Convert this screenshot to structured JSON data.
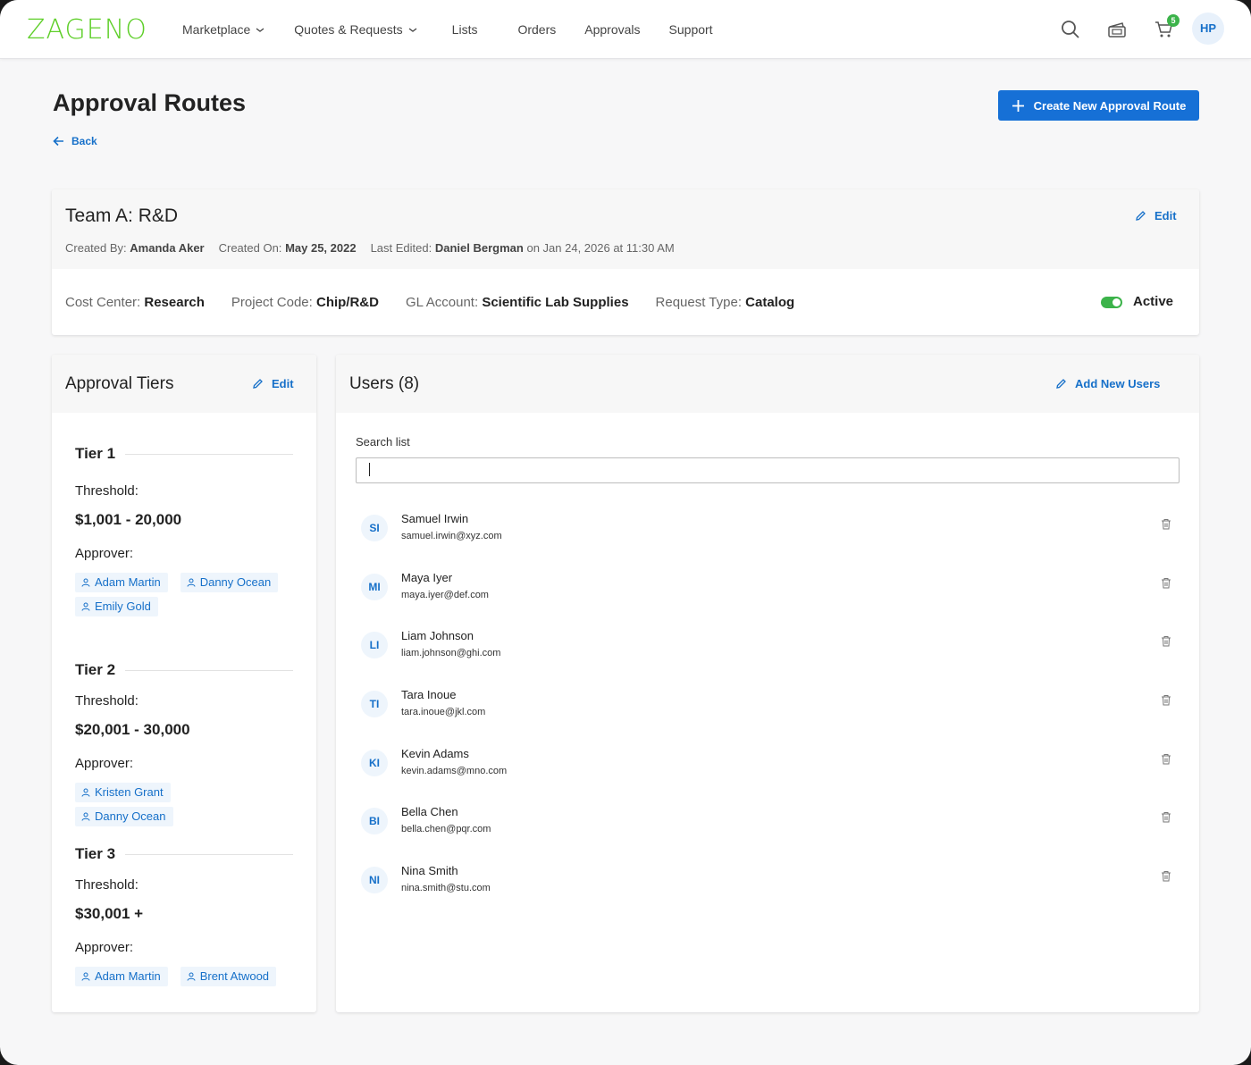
{
  "header": {
    "logo": "ZAGENO",
    "nav": [
      {
        "label": "Marketplace",
        "has_dropdown": true
      },
      {
        "label": "Quotes & Requests",
        "has_dropdown": true
      },
      {
        "label": "Lists",
        "has_dropdown": false
      },
      {
        "label": "Orders",
        "has_dropdown": false
      },
      {
        "label": "Approvals",
        "has_dropdown": false
      },
      {
        "label": "Support",
        "has_dropdown": false
      }
    ],
    "icons": [
      "search-icon",
      "quotes-icon",
      "cart-icon"
    ],
    "cart_count": "5",
    "avatar_initials": "HP"
  },
  "page": {
    "title": "Approval Routes",
    "back_label": "Back",
    "create_button": "Create New Approval Route"
  },
  "route": {
    "name": "Team A: R&D",
    "edit_label": "Edit",
    "created_by_label": "Created By:",
    "created_by": "Amanda Aker",
    "created_on_label": "Created On:",
    "created_on": "May 25, 2022",
    "last_edited_label": "Last Edited:",
    "last_edited_by": "Daniel Bergman",
    "last_edited_on": "on Jan 24, 2026 at 11:30 AM",
    "cost_center_label": "Cost Center:",
    "cost_center": "Research",
    "project_code_label": "Project Code:",
    "project_code": "Chip/R&D",
    "gl_account_label": "GL Account:",
    "gl_account": "Scientific Lab Supplies",
    "request_type_label": "Request Type:",
    "request_type": "Catalog",
    "status": "Active",
    "status_on": true
  },
  "tiers_panel": {
    "title": "Approval Tiers",
    "edit_label": "Edit",
    "threshold_label": "Threshold:",
    "approver_label": "Approver:",
    "tiers": [
      {
        "name": "Tier 1",
        "threshold": "$1,001 - 20,000",
        "approvers": [
          "Adam Martin",
          "Danny Ocean",
          "Emily Gold"
        ]
      },
      {
        "name": "Tier 2",
        "threshold": "$20,001 - 30,000",
        "approvers": [
          "Kristen Grant",
          "Danny Ocean"
        ]
      },
      {
        "name": "Tier 3",
        "threshold": "$30,001 +",
        "approvers": [
          "Adam Martin",
          "Brent Atwood"
        ]
      }
    ]
  },
  "users_panel": {
    "title": "Users (8)",
    "add_label": "Add New Users",
    "search_label": "Search list",
    "search_value": "",
    "users": [
      {
        "initials": "SI",
        "name": "Samuel Irwin",
        "email": "samuel.irwin@xyz.com"
      },
      {
        "initials": "MI",
        "name": "Maya Iyer",
        "email": "maya.iyer@def.com"
      },
      {
        "initials": "LI",
        "name": "Liam Johnson",
        "email": "liam.johnson@ghi.com"
      },
      {
        "initials": "TI",
        "name": "Tara Inoue",
        "email": "tara.inoue@jkl.com"
      },
      {
        "initials": "KI",
        "name": "Kevin Adams",
        "email": "kevin.adams@mno.com"
      },
      {
        "initials": "BI",
        "name": "Bella Chen",
        "email": "bella.chen@pqr.com"
      },
      {
        "initials": "NI",
        "name": "Nina Smith",
        "email": "nina.smith@stu.com"
      }
    ]
  },
  "colors": {
    "brand": "#5fcf2a",
    "accent": "#1670d6",
    "active": "#3cb34a"
  }
}
